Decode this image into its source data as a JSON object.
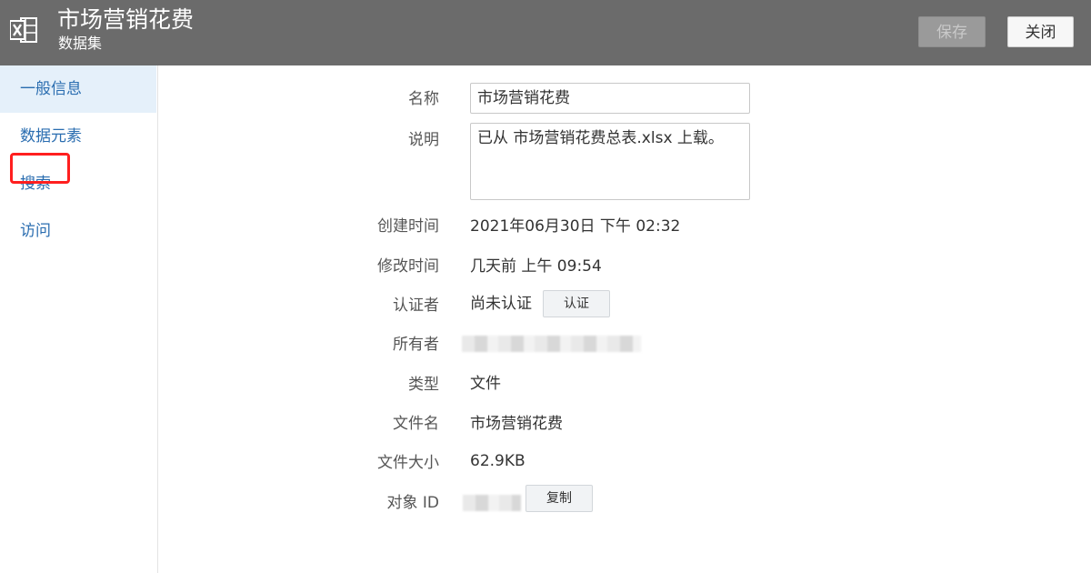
{
  "header": {
    "title": "市场营销花费",
    "subtitle": "数据集",
    "save_label": "保存",
    "close_label": "关闭",
    "logo_icon": "excel-file-icon"
  },
  "sidebar": {
    "items": [
      {
        "label": "一般信息",
        "active": true
      },
      {
        "label": "数据元素",
        "active": false
      },
      {
        "label": "搜索",
        "active": false
      },
      {
        "label": "访问",
        "active": false
      }
    ]
  },
  "form": {
    "name": {
      "label": "名称",
      "value": "市场营销花费"
    },
    "description": {
      "label": "说明",
      "value": "已从 市场营销花费总表.xlsx 上载。"
    },
    "created": {
      "label": "创建时间",
      "value": "2021年06月30日 下午 02:32"
    },
    "modified": {
      "label": "修改时间",
      "value": "几天前 上午 09:54"
    },
    "certifier": {
      "label": "认证者",
      "value": "尚未认证",
      "button_label": "认证"
    },
    "owner": {
      "label": "所有者"
    },
    "type": {
      "label": "类型",
      "value": "文件"
    },
    "filename": {
      "label": "文件名",
      "value": "市场营销花费"
    },
    "filesize": {
      "label": "文件大小",
      "value": "62.9KB"
    },
    "object_id": {
      "label": "对象 ID",
      "button_label": "复制"
    }
  },
  "colors": {
    "header_bg": "#6b6b6b",
    "link": "#2a6db0",
    "active_bg": "#e5f0fa",
    "highlight": "#ff1f1f"
  }
}
